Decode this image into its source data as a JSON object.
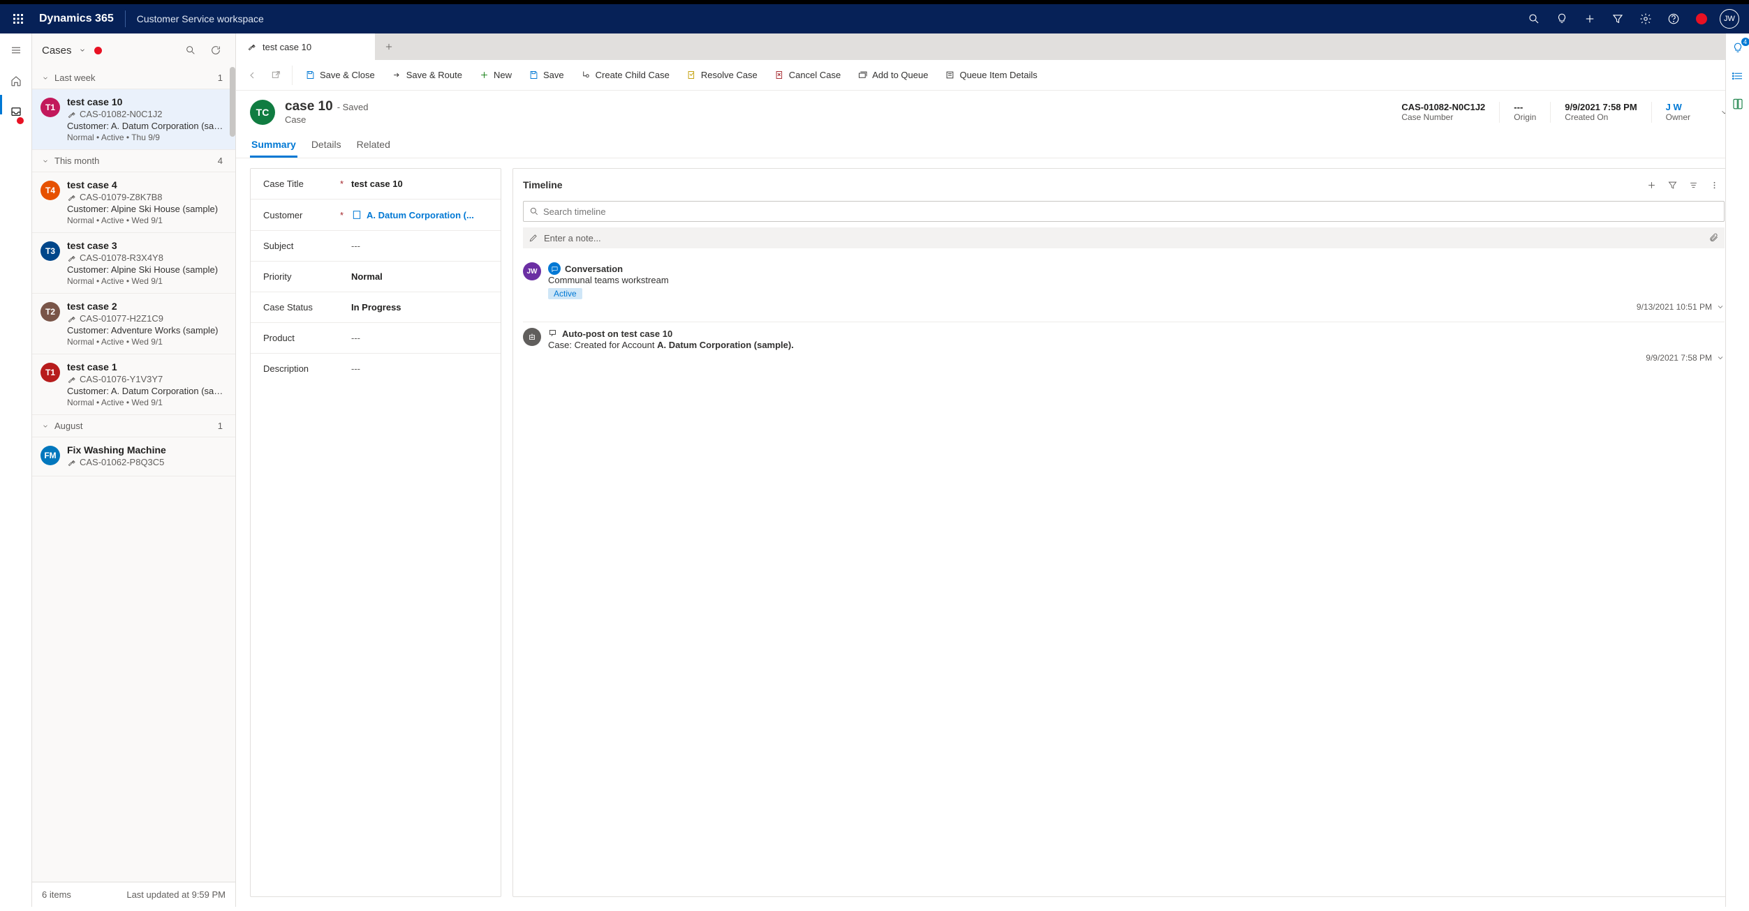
{
  "header": {
    "product": "Dynamics 365",
    "workspace": "Customer Service workspace",
    "user_initials": "JW"
  },
  "case_panel": {
    "title": "Cases",
    "footer_count": "6 items",
    "footer_updated": "Last updated at 9:59 PM",
    "groups": [
      {
        "label": "Last week",
        "count": "1"
      },
      {
        "label": "This month",
        "count": "4"
      },
      {
        "label": "August",
        "count": "1"
      }
    ],
    "items": [
      {
        "badge": "T1",
        "badge_color": "#c2185b",
        "title": "test case 10",
        "number": "CAS-01082-N0C1J2",
        "customer": "Customer: A. Datum Corporation (sampl...",
        "meta": "Normal  •  Active  •  Thu 9/9"
      },
      {
        "badge": "T4",
        "badge_color": "#e65100",
        "title": "test case 4",
        "number": "CAS-01079-Z8K7B8",
        "customer": "Customer: Alpine Ski House (sample)",
        "meta": "Normal  •  Active  •  Wed 9/1"
      },
      {
        "badge": "T3",
        "badge_color": "#00468a",
        "title": "test case 3",
        "number": "CAS-01078-R3X4Y8",
        "customer": "Customer: Alpine Ski House (sample)",
        "meta": "Normal  •  Active  •  Wed 9/1"
      },
      {
        "badge": "T2",
        "badge_color": "#795548",
        "title": "test case 2",
        "number": "CAS-01077-H2Z1C9",
        "customer": "Customer: Adventure Works (sample)",
        "meta": "Normal  •  Active  •  Wed 9/1"
      },
      {
        "badge": "T1",
        "badge_color": "#b71c1c",
        "title": "test case 1",
        "number": "CAS-01076-Y1V3Y7",
        "customer": "Customer: A. Datum Corporation (sampl...",
        "meta": "Normal  •  Active  •  Wed 9/1"
      },
      {
        "badge": "FM",
        "badge_color": "#0277bd",
        "title": "Fix Washing Machine",
        "number": "CAS-01062-P8Q3C5",
        "customer": "",
        "meta": ""
      }
    ]
  },
  "tabs": {
    "active_tab": "test case 10"
  },
  "commands": {
    "save_close": "Save & Close",
    "save_route": "Save & Route",
    "new": "New",
    "save": "Save",
    "child_case": "Create Child Case",
    "resolve": "Resolve Case",
    "cancel": "Cancel Case",
    "add_queue": "Add to Queue",
    "queue_details": "Queue Item Details"
  },
  "record": {
    "badge": "TC",
    "title": "case 10",
    "saved_label": "- Saved",
    "subtitle": "Case",
    "meta": [
      {
        "value": "CAS-01082-N0C1J2",
        "label": "Case Number"
      },
      {
        "value": "---",
        "label": "Origin"
      },
      {
        "value": "9/9/2021 7:58 PM",
        "label": "Created On"
      },
      {
        "value": "J W",
        "label": "Owner",
        "link": true
      }
    ],
    "pivot": {
      "summary": "Summary",
      "details": "Details",
      "related": "Related"
    }
  },
  "form": {
    "case_title": {
      "label": "Case Title",
      "value": "test case 10",
      "required": true
    },
    "customer": {
      "label": "Customer",
      "value": "A. Datum Corporation (...",
      "required": true,
      "link": true
    },
    "subject": {
      "label": "Subject",
      "value": "---"
    },
    "priority": {
      "label": "Priority",
      "value": "Normal"
    },
    "case_status": {
      "label": "Case Status",
      "value": "In Progress"
    },
    "product": {
      "label": "Product",
      "value": "---"
    },
    "description": {
      "label": "Description",
      "value": "---"
    }
  },
  "timeline": {
    "title": "Timeline",
    "search_placeholder": "Search timeline",
    "note_placeholder": "Enter a note...",
    "items": [
      {
        "avatar": "JW",
        "avatar_color": "#6b2fa3",
        "icon_color": "#0078d4",
        "title": "Conversation",
        "sub": "Communal teams workstream",
        "status": "Active",
        "timestamp": "9/13/2021 10:51 PM"
      },
      {
        "avatar_icon": true,
        "avatar_color": "#605e5c",
        "title": "Auto-post on test case 10",
        "sub_prefix": "Case: Created for Account ",
        "sub_bold": "A. Datum Corporation (sample).",
        "timestamp": "9/9/2021 7:58 PM"
      }
    ]
  },
  "right_rail": {
    "badge": "4"
  }
}
